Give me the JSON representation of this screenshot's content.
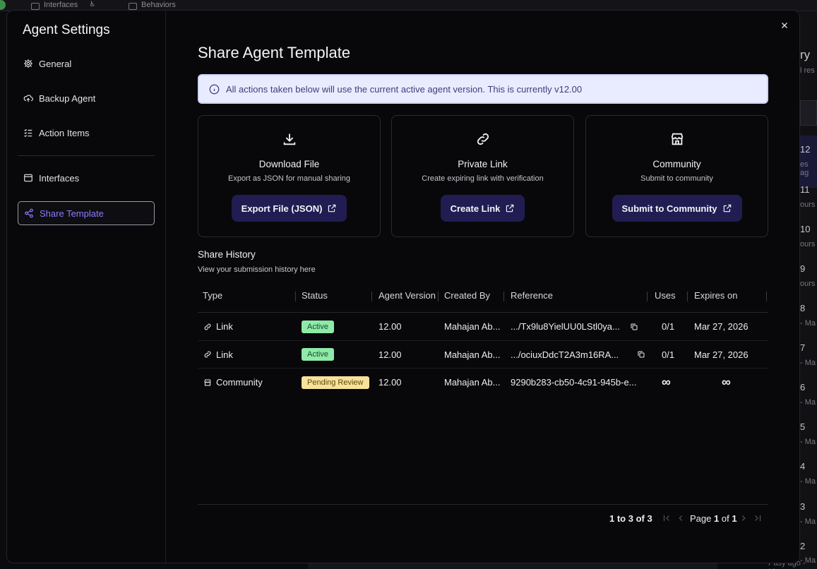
{
  "background": {
    "tabs": [
      "Interfaces",
      "Behaviors"
    ],
    "right_numbers": [
      "12",
      "11",
      "10",
      "9",
      "8",
      "7",
      "6",
      "5",
      "4",
      "3",
      "2"
    ],
    "right_header": "ry",
    "right_sub": "l res",
    "right_fragments": [
      "es ag",
      "ours",
      "ours",
      "ours",
      "- Ma",
      "- Ma",
      "- Ma",
      "- Ma",
      "- Ma",
      "- Ma",
      "- Ma"
    ],
    "bottom_text": "Pasy ago - Ma"
  },
  "sidebar": {
    "title": "Agent Settings",
    "items": [
      {
        "label": "General",
        "icon": "gear-icon"
      },
      {
        "label": "Backup Agent",
        "icon": "cloud-upload-icon"
      },
      {
        "label": "Action Items",
        "icon": "checklist-icon"
      },
      {
        "label": "Interfaces",
        "icon": "window-icon"
      },
      {
        "label": "Share Template",
        "icon": "share-icon",
        "active": true
      }
    ]
  },
  "main": {
    "title": "Share Agent Template",
    "banner": "All actions taken below will use the current active agent version. This is currently v12.00",
    "cards": [
      {
        "title": "Download File",
        "desc": "Export as JSON for manual sharing",
        "button": "Export File (JSON)",
        "icon": "download-icon"
      },
      {
        "title": "Private Link",
        "desc": "Create expiring link with verification",
        "button": "Create Link",
        "icon": "link-icon"
      },
      {
        "title": "Community",
        "desc": "Submit to community",
        "button": "Submit to Community",
        "icon": "store-icon"
      }
    ],
    "history": {
      "title": "Share History",
      "subtitle": "View your submission history here",
      "columns": [
        "Type",
        "Status",
        "Agent Version",
        "Created By",
        "Reference",
        "Uses",
        "Expires on"
      ],
      "rows": [
        {
          "type": "Link",
          "type_icon": "link-icon",
          "status": "Active",
          "status_kind": "active",
          "version": "12.00",
          "created_by": "Mahajan Ab...",
          "reference": ".../Tx9lu8YielUU0LStl0ya...",
          "copyable": true,
          "uses": "0/1",
          "expires": "Mar 27, 2026"
        },
        {
          "type": "Link",
          "type_icon": "link-icon",
          "status": "Active",
          "status_kind": "active",
          "version": "12.00",
          "created_by": "Mahajan Ab...",
          "reference": ".../ociuxDdcT2A3m16RA...",
          "copyable": true,
          "uses": "0/1",
          "expires": "Mar 27, 2026"
        },
        {
          "type": "Community",
          "type_icon": "store-icon",
          "status": "Pending Review",
          "status_kind": "pending",
          "version": "12.00",
          "created_by": "Mahajan Ab...",
          "reference": "9290b283-cb50-4c91-945b-e...",
          "copyable": false,
          "uses": "∞",
          "expires": "∞"
        }
      ]
    },
    "pagination": {
      "range": "1 to 3 of 3",
      "page_prefix": "Page",
      "page": "1",
      "of": "of",
      "total": "1"
    }
  },
  "colors": {
    "accent": "#8b7cff",
    "button_bg": "#211d52",
    "banner_bg": "#e9ecff",
    "active_badge": "#8eeaa8",
    "pending_badge": "#f7e29a"
  }
}
